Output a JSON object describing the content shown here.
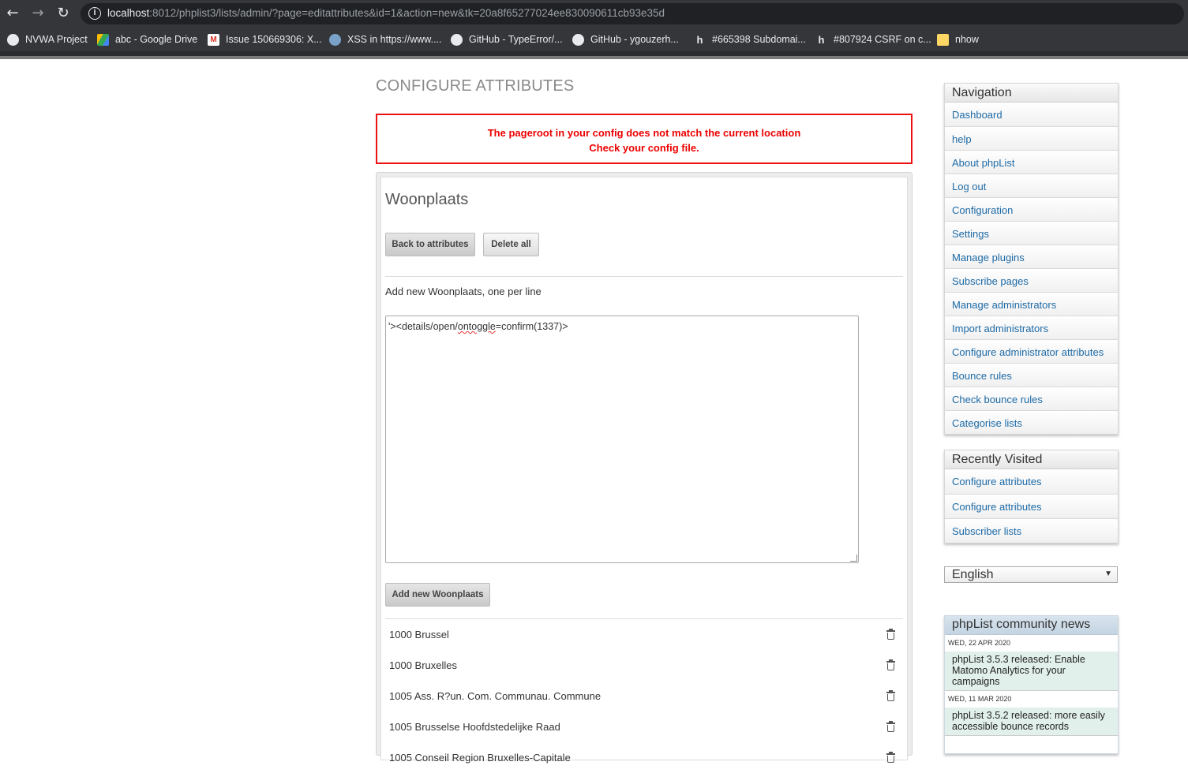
{
  "browser": {
    "url_host": "localhost",
    "url_rest": ":8012/phplist3/lists/admin/?page=editattributes&id=1&action=new&tk=20a8f65277024ee830090611cb93e35d",
    "bookmarks": [
      {
        "label": "NVWA Project",
        "icon": "github-icon"
      },
      {
        "label": "abc - Google Drive",
        "icon": "google-drive-icon"
      },
      {
        "label": "Issue 150669306: X...",
        "icon": "gmail-icon"
      },
      {
        "label": "XSS in https://www....",
        "icon": "bug-icon"
      },
      {
        "label": "GitHub - TypeError/...",
        "icon": "github-icon"
      },
      {
        "label": "GitHub - ygouzerh...",
        "icon": "github-icon"
      },
      {
        "label": "#665398 Subdomai...",
        "icon": "hackerone-icon"
      },
      {
        "label": "#807924 CSRF on c...",
        "icon": "hackerone-icon"
      },
      {
        "label": "nhow",
        "icon": "folder-icon"
      }
    ]
  },
  "page": {
    "title": "CONFIGURE ATTRIBUTES",
    "alert_line1": "The pageroot in your config does not match the current location",
    "alert_line2": "Check your config file."
  },
  "attribute": {
    "name": "Woonplaats",
    "back_button": "Back to attributes",
    "delete_all_button": "Delete all",
    "add_label": "Add new Woonplaats, one per line",
    "textarea_before": "'><details/open/",
    "textarea_misspelled": "ontoggle",
    "textarea_after": "=confirm(1337)>",
    "add_button": "Add new Woonplaats",
    "values": [
      "1000 Brussel",
      "1000 Bruxelles",
      "1005 Ass. R?un. Com. Communau. Commune",
      "1005 Brusselse Hoofdstedelijke Raad",
      "1005 Conseil Region Bruxelles-Capitale"
    ]
  },
  "sidebar": {
    "navigation_title": "Navigation",
    "navigation": [
      "Dashboard",
      "help",
      "About phpList",
      "Log out",
      "Configuration",
      "Settings",
      "Manage plugins",
      "Subscribe pages",
      "Manage administrators",
      "Import administrators",
      "Configure administrator attributes",
      "Bounce rules",
      "Check bounce rules",
      "Categorise lists"
    ],
    "recent_title": "Recently Visited",
    "recent": [
      "Configure attributes",
      "Configure attributes",
      "Subscriber lists"
    ],
    "language": "English",
    "news_title": "phpList community news",
    "news": [
      {
        "date": "WED, 22 APR 2020",
        "text": "phpList 3.5.3 released: Enable Matomo Analytics for your campaigns"
      },
      {
        "date": "WED, 11 MAR 2020",
        "text": "phpList 3.5.2 released: more easily accessible bounce records"
      }
    ]
  }
}
